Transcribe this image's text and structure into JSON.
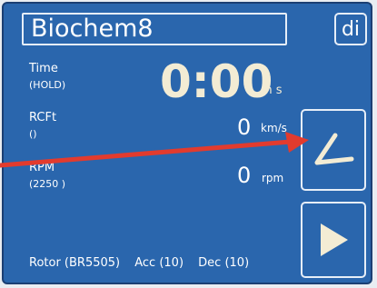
{
  "header": {
    "title": "Biochem8",
    "di_label": "di"
  },
  "time": {
    "label": "Time",
    "mode": "(HOLD)",
    "value": "0:00",
    "unit": "m s"
  },
  "rcf": {
    "label": "RCFt",
    "setting": "()",
    "value": "0",
    "unit": "km/s"
  },
  "rpm": {
    "label": "RPM",
    "setting": "(2250 )",
    "value": "0",
    "unit": "rpm"
  },
  "footer": {
    "rotor": "Rotor (BR5505)",
    "acc": "Acc (10)",
    "dec": "Dec (10)"
  },
  "buttons": {
    "set_icon": "angle-icon",
    "start_icon": "play-icon"
  },
  "colors": {
    "panel": "#2a66ad",
    "arrow": "#e23b2e",
    "time": "#f3ecd4",
    "border": "#e6eef8"
  }
}
